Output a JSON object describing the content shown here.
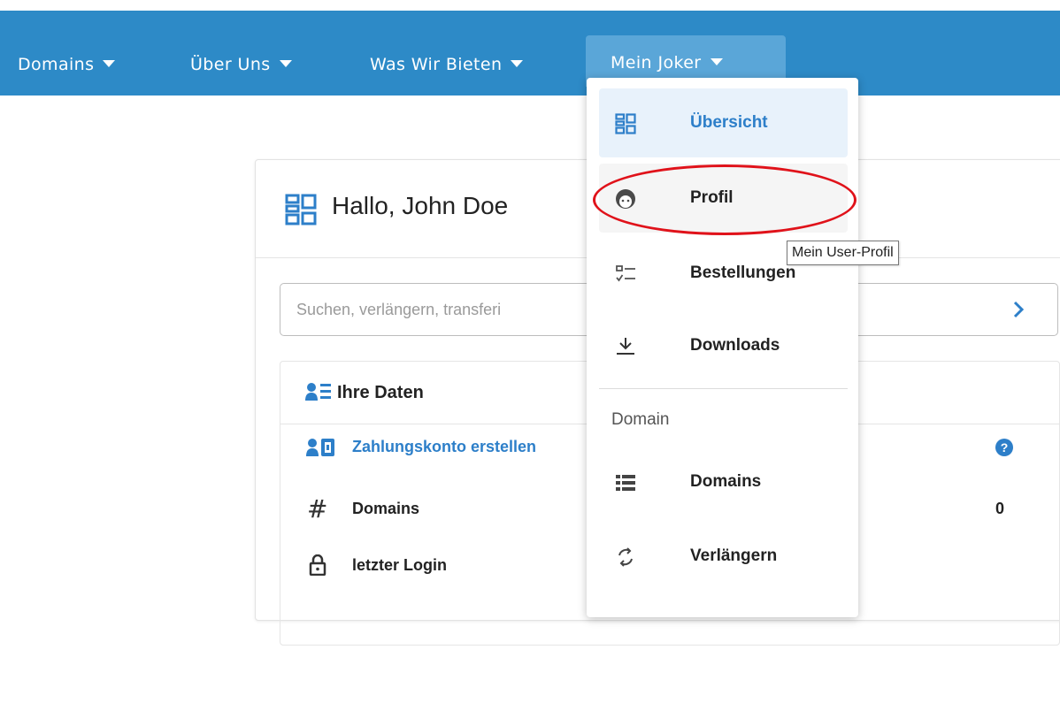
{
  "nav": {
    "items": [
      {
        "label": "Domains"
      },
      {
        "label": "Über Uns"
      },
      {
        "label": "Was Wir Bieten"
      },
      {
        "label": "Mein Joker"
      }
    ]
  },
  "dashboard": {
    "greeting": "Hallo, John Doe",
    "search_placeholder": "Suchen, verlängern, transferi",
    "panel_title": "Ihre Daten",
    "rows": [
      {
        "label": "Zahlungskonto erstellen",
        "value": ""
      },
      {
        "label": "Domains",
        "value": "0"
      },
      {
        "label": "letzter Login",
        "value": ""
      }
    ]
  },
  "menu": {
    "items": [
      {
        "label": "Übersicht",
        "icon": "dashboard-icon"
      },
      {
        "label": "Profil",
        "icon": "user-face-icon"
      },
      {
        "label": "Bestellungen",
        "icon": "checklist-icon"
      },
      {
        "label": "Downloads",
        "icon": "download-icon"
      }
    ],
    "section_label": "Domain",
    "domain_items": [
      {
        "label": "Domains",
        "icon": "list-icon"
      },
      {
        "label": "Verlängern",
        "icon": "renew-icon"
      }
    ]
  },
  "tooltip": "Mein User-Profil",
  "colors": {
    "nav_bg": "#2d8ac7",
    "accent": "#2d7fc9",
    "annotation": "#e0121a"
  }
}
